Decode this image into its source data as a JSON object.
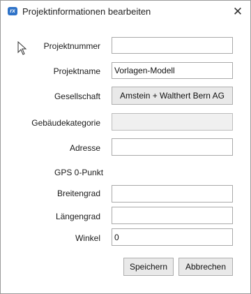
{
  "window": {
    "title": "Projektinformationen bearbeiten",
    "app_icon_text": "rx",
    "close_glyph": "✕",
    "accent_color": "#2f73c8"
  },
  "form": {
    "projektnummer_label": "Projektnummer",
    "projektnummer_value": "",
    "projektname_label": "Projektname",
    "projektname_value": "Vorlagen-Modell",
    "gesellschaft_label": "Gesellschaft",
    "gesellschaft_button": "Amstein + Walthert Bern AG",
    "gebaeudekategorie_label": "Gebäudekategorie",
    "gebaeudekategorie_value": "",
    "adresse_label": "Adresse",
    "adresse_value": "",
    "gps_section_label": "GPS 0-Punkt",
    "breitengrad_label": "Breitengrad",
    "breitengrad_value": "",
    "laengengrad_label": "Längengrad",
    "laengengrad_value": "",
    "winkel_label": "Winkel",
    "winkel_value": "0"
  },
  "buttons": {
    "save": "Speichern",
    "cancel": "Abbrechen"
  }
}
